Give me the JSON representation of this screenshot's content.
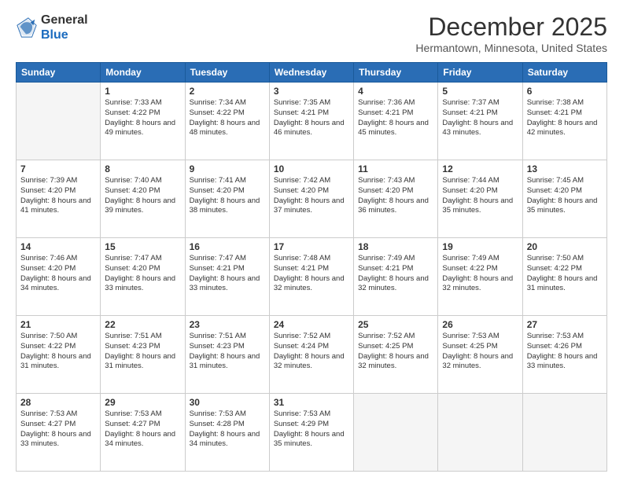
{
  "header": {
    "logo_general": "General",
    "logo_blue": "Blue",
    "month_title": "December 2025",
    "location": "Hermantown, Minnesota, United States"
  },
  "days_of_week": [
    "Sunday",
    "Monday",
    "Tuesday",
    "Wednesday",
    "Thursday",
    "Friday",
    "Saturday"
  ],
  "weeks": [
    [
      {
        "day": "",
        "sunrise": "",
        "sunset": "",
        "daylight": "",
        "empty": true
      },
      {
        "day": "1",
        "sunrise": "Sunrise: 7:33 AM",
        "sunset": "Sunset: 4:22 PM",
        "daylight": "Daylight: 8 hours and 49 minutes."
      },
      {
        "day": "2",
        "sunrise": "Sunrise: 7:34 AM",
        "sunset": "Sunset: 4:22 PM",
        "daylight": "Daylight: 8 hours and 48 minutes."
      },
      {
        "day": "3",
        "sunrise": "Sunrise: 7:35 AM",
        "sunset": "Sunset: 4:21 PM",
        "daylight": "Daylight: 8 hours and 46 minutes."
      },
      {
        "day": "4",
        "sunrise": "Sunrise: 7:36 AM",
        "sunset": "Sunset: 4:21 PM",
        "daylight": "Daylight: 8 hours and 45 minutes."
      },
      {
        "day": "5",
        "sunrise": "Sunrise: 7:37 AM",
        "sunset": "Sunset: 4:21 PM",
        "daylight": "Daylight: 8 hours and 43 minutes."
      },
      {
        "day": "6",
        "sunrise": "Sunrise: 7:38 AM",
        "sunset": "Sunset: 4:21 PM",
        "daylight": "Daylight: 8 hours and 42 minutes."
      }
    ],
    [
      {
        "day": "7",
        "sunrise": "Sunrise: 7:39 AM",
        "sunset": "Sunset: 4:20 PM",
        "daylight": "Daylight: 8 hours and 41 minutes."
      },
      {
        "day": "8",
        "sunrise": "Sunrise: 7:40 AM",
        "sunset": "Sunset: 4:20 PM",
        "daylight": "Daylight: 8 hours and 39 minutes."
      },
      {
        "day": "9",
        "sunrise": "Sunrise: 7:41 AM",
        "sunset": "Sunset: 4:20 PM",
        "daylight": "Daylight: 8 hours and 38 minutes."
      },
      {
        "day": "10",
        "sunrise": "Sunrise: 7:42 AM",
        "sunset": "Sunset: 4:20 PM",
        "daylight": "Daylight: 8 hours and 37 minutes."
      },
      {
        "day": "11",
        "sunrise": "Sunrise: 7:43 AM",
        "sunset": "Sunset: 4:20 PM",
        "daylight": "Daylight: 8 hours and 36 minutes."
      },
      {
        "day": "12",
        "sunrise": "Sunrise: 7:44 AM",
        "sunset": "Sunset: 4:20 PM",
        "daylight": "Daylight: 8 hours and 35 minutes."
      },
      {
        "day": "13",
        "sunrise": "Sunrise: 7:45 AM",
        "sunset": "Sunset: 4:20 PM",
        "daylight": "Daylight: 8 hours and 35 minutes."
      }
    ],
    [
      {
        "day": "14",
        "sunrise": "Sunrise: 7:46 AM",
        "sunset": "Sunset: 4:20 PM",
        "daylight": "Daylight: 8 hours and 34 minutes."
      },
      {
        "day": "15",
        "sunrise": "Sunrise: 7:47 AM",
        "sunset": "Sunset: 4:20 PM",
        "daylight": "Daylight: 8 hours and 33 minutes."
      },
      {
        "day": "16",
        "sunrise": "Sunrise: 7:47 AM",
        "sunset": "Sunset: 4:21 PM",
        "daylight": "Daylight: 8 hours and 33 minutes."
      },
      {
        "day": "17",
        "sunrise": "Sunrise: 7:48 AM",
        "sunset": "Sunset: 4:21 PM",
        "daylight": "Daylight: 8 hours and 32 minutes."
      },
      {
        "day": "18",
        "sunrise": "Sunrise: 7:49 AM",
        "sunset": "Sunset: 4:21 PM",
        "daylight": "Daylight: 8 hours and 32 minutes."
      },
      {
        "day": "19",
        "sunrise": "Sunrise: 7:49 AM",
        "sunset": "Sunset: 4:22 PM",
        "daylight": "Daylight: 8 hours and 32 minutes."
      },
      {
        "day": "20",
        "sunrise": "Sunrise: 7:50 AM",
        "sunset": "Sunset: 4:22 PM",
        "daylight": "Daylight: 8 hours and 31 minutes."
      }
    ],
    [
      {
        "day": "21",
        "sunrise": "Sunrise: 7:50 AM",
        "sunset": "Sunset: 4:22 PM",
        "daylight": "Daylight: 8 hours and 31 minutes."
      },
      {
        "day": "22",
        "sunrise": "Sunrise: 7:51 AM",
        "sunset": "Sunset: 4:23 PM",
        "daylight": "Daylight: 8 hours and 31 minutes."
      },
      {
        "day": "23",
        "sunrise": "Sunrise: 7:51 AM",
        "sunset": "Sunset: 4:23 PM",
        "daylight": "Daylight: 8 hours and 31 minutes."
      },
      {
        "day": "24",
        "sunrise": "Sunrise: 7:52 AM",
        "sunset": "Sunset: 4:24 PM",
        "daylight": "Daylight: 8 hours and 32 minutes."
      },
      {
        "day": "25",
        "sunrise": "Sunrise: 7:52 AM",
        "sunset": "Sunset: 4:25 PM",
        "daylight": "Daylight: 8 hours and 32 minutes."
      },
      {
        "day": "26",
        "sunrise": "Sunrise: 7:53 AM",
        "sunset": "Sunset: 4:25 PM",
        "daylight": "Daylight: 8 hours and 32 minutes."
      },
      {
        "day": "27",
        "sunrise": "Sunrise: 7:53 AM",
        "sunset": "Sunset: 4:26 PM",
        "daylight": "Daylight: 8 hours and 33 minutes."
      }
    ],
    [
      {
        "day": "28",
        "sunrise": "Sunrise: 7:53 AM",
        "sunset": "Sunset: 4:27 PM",
        "daylight": "Daylight: 8 hours and 33 minutes."
      },
      {
        "day": "29",
        "sunrise": "Sunrise: 7:53 AM",
        "sunset": "Sunset: 4:27 PM",
        "daylight": "Daylight: 8 hours and 34 minutes."
      },
      {
        "day": "30",
        "sunrise": "Sunrise: 7:53 AM",
        "sunset": "Sunset: 4:28 PM",
        "daylight": "Daylight: 8 hours and 34 minutes."
      },
      {
        "day": "31",
        "sunrise": "Sunrise: 7:53 AM",
        "sunset": "Sunset: 4:29 PM",
        "daylight": "Daylight: 8 hours and 35 minutes."
      },
      {
        "day": "",
        "sunrise": "",
        "sunset": "",
        "daylight": "",
        "empty": true
      },
      {
        "day": "",
        "sunrise": "",
        "sunset": "",
        "daylight": "",
        "empty": true
      },
      {
        "day": "",
        "sunrise": "",
        "sunset": "",
        "daylight": "",
        "empty": true
      }
    ]
  ]
}
